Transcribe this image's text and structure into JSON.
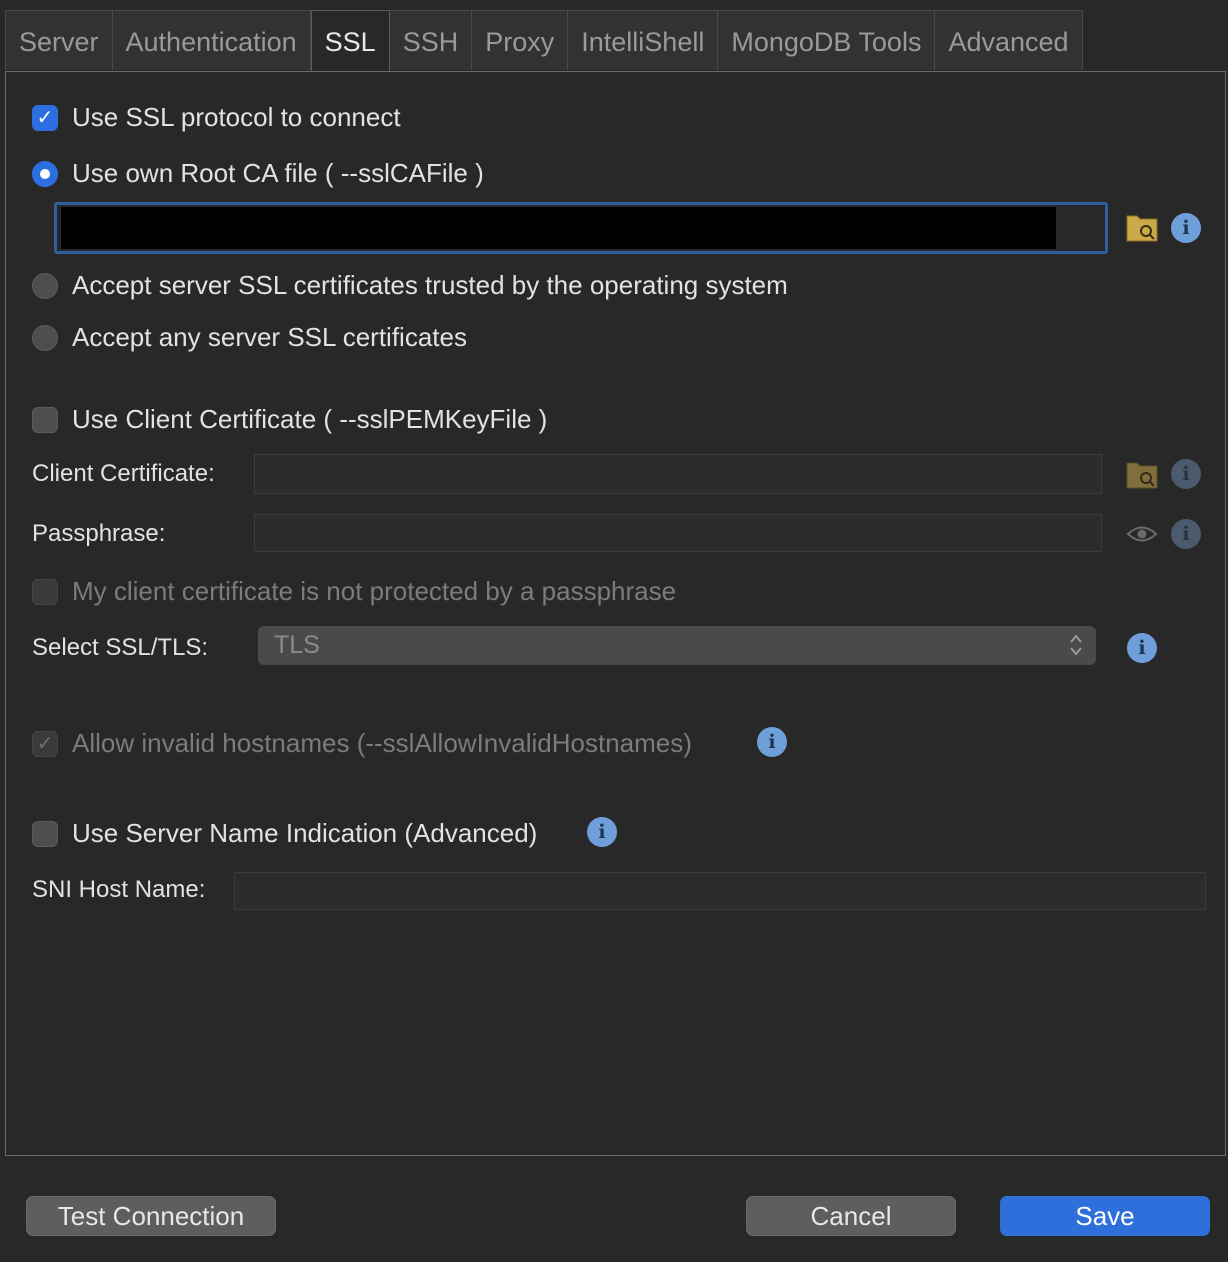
{
  "tabs": [
    "Server",
    "Authentication",
    "SSL",
    "SSH",
    "Proxy",
    "IntelliShell",
    "MongoDB Tools",
    "Advanced"
  ],
  "active_tab": "SSL",
  "ssl": {
    "use_ssl_label": "Use SSL protocol to connect",
    "own_root_ca_label": "Use own Root CA file ( --sslCAFile )",
    "trusted_os_label": "Accept server SSL certificates trusted by the operating system",
    "any_cert_label": "Accept any server SSL certificates",
    "client_cert_check_label": "Use Client Certificate ( --sslPEMKeyFile )",
    "client_certificate_label": "Client Certificate:",
    "passphrase_label": "Passphrase:",
    "no_passphrase_label": "My client certificate is not protected by a passphrase",
    "select_ssl_tls_label": "Select SSL/TLS:",
    "select_ssl_tls_value": "TLS",
    "allow_invalid_label": "Allow invalid hostnames (--sslAllowInvalidHostnames)",
    "sni_label": "Use Server Name Indication (Advanced)",
    "sni_host_label": "SNI Host Name:"
  },
  "buttons": {
    "test": "Test Connection",
    "cancel": "Cancel",
    "save": "Save"
  },
  "info_glyph": "i",
  "colors": {
    "accent": "#2f6fdc",
    "info": "#6f9fd8"
  }
}
